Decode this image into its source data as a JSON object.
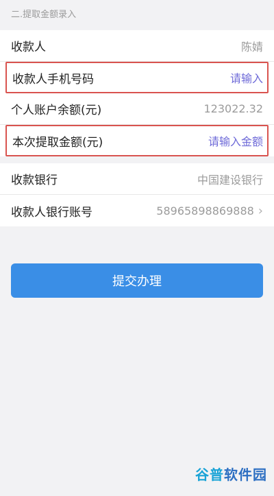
{
  "section": {
    "title": "二.提取金额录入"
  },
  "form": {
    "payee": {
      "label": "收款人",
      "value": "陈婧"
    },
    "payee_phone": {
      "label": "收款人手机号码",
      "placeholder": "请输入"
    },
    "balance": {
      "label": "个人账户余额(元)",
      "value": "123022.32"
    },
    "withdraw_amount": {
      "label": "本次提取金额(元)",
      "placeholder": "请输入金额"
    },
    "bank": {
      "label": "收款银行",
      "value": "中国建设银行"
    },
    "bank_account": {
      "label": "收款人银行账号",
      "value": "58965898869888",
      "chevron": "›"
    }
  },
  "actions": {
    "submit_label": "提交办理"
  },
  "watermark": {
    "part1": "谷普",
    "part2": "软件园"
  },
  "colors": {
    "accent": "#3a8ee6",
    "placeholder": "#6e6ad8",
    "highlight_border": "#d9534f"
  }
}
